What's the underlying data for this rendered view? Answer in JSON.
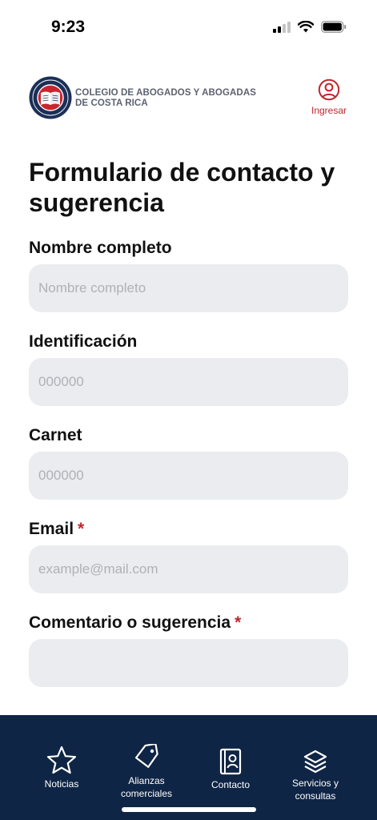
{
  "status": {
    "time": "9:23"
  },
  "header": {
    "org_name_line1": "COLEGIO DE ABOGADOS Y ABOGADAS",
    "org_name_line2": "DE COSTA RICA",
    "login_label": "Ingresar",
    "accent_color": "#c0272d"
  },
  "page": {
    "title": "Formulario de contacto y sugerencia"
  },
  "form": {
    "fields": [
      {
        "label": "Nombre completo",
        "placeholder": "Nombre completo",
        "value": "",
        "required": false
      },
      {
        "label": "Identificación",
        "placeholder": "000000",
        "value": "",
        "required": false
      },
      {
        "label": "Carnet",
        "placeholder": "000000",
        "value": "",
        "required": false
      },
      {
        "label": "Email",
        "placeholder": "example@mail.com",
        "value": "",
        "required": true
      },
      {
        "label": "Comentario o sugerencia",
        "placeholder": "",
        "value": "",
        "required": true
      }
    ],
    "required_mark": "*"
  },
  "tabbar": {
    "background": "#0f2545",
    "items": [
      {
        "label": "Noticias",
        "icon": "star-icon"
      },
      {
        "label": "Alianzas comerciales",
        "icon": "tag-icon"
      },
      {
        "label": "Contacto",
        "icon": "contact-book-icon"
      },
      {
        "label": "Servicios y consultas",
        "icon": "layers-icon"
      }
    ]
  }
}
